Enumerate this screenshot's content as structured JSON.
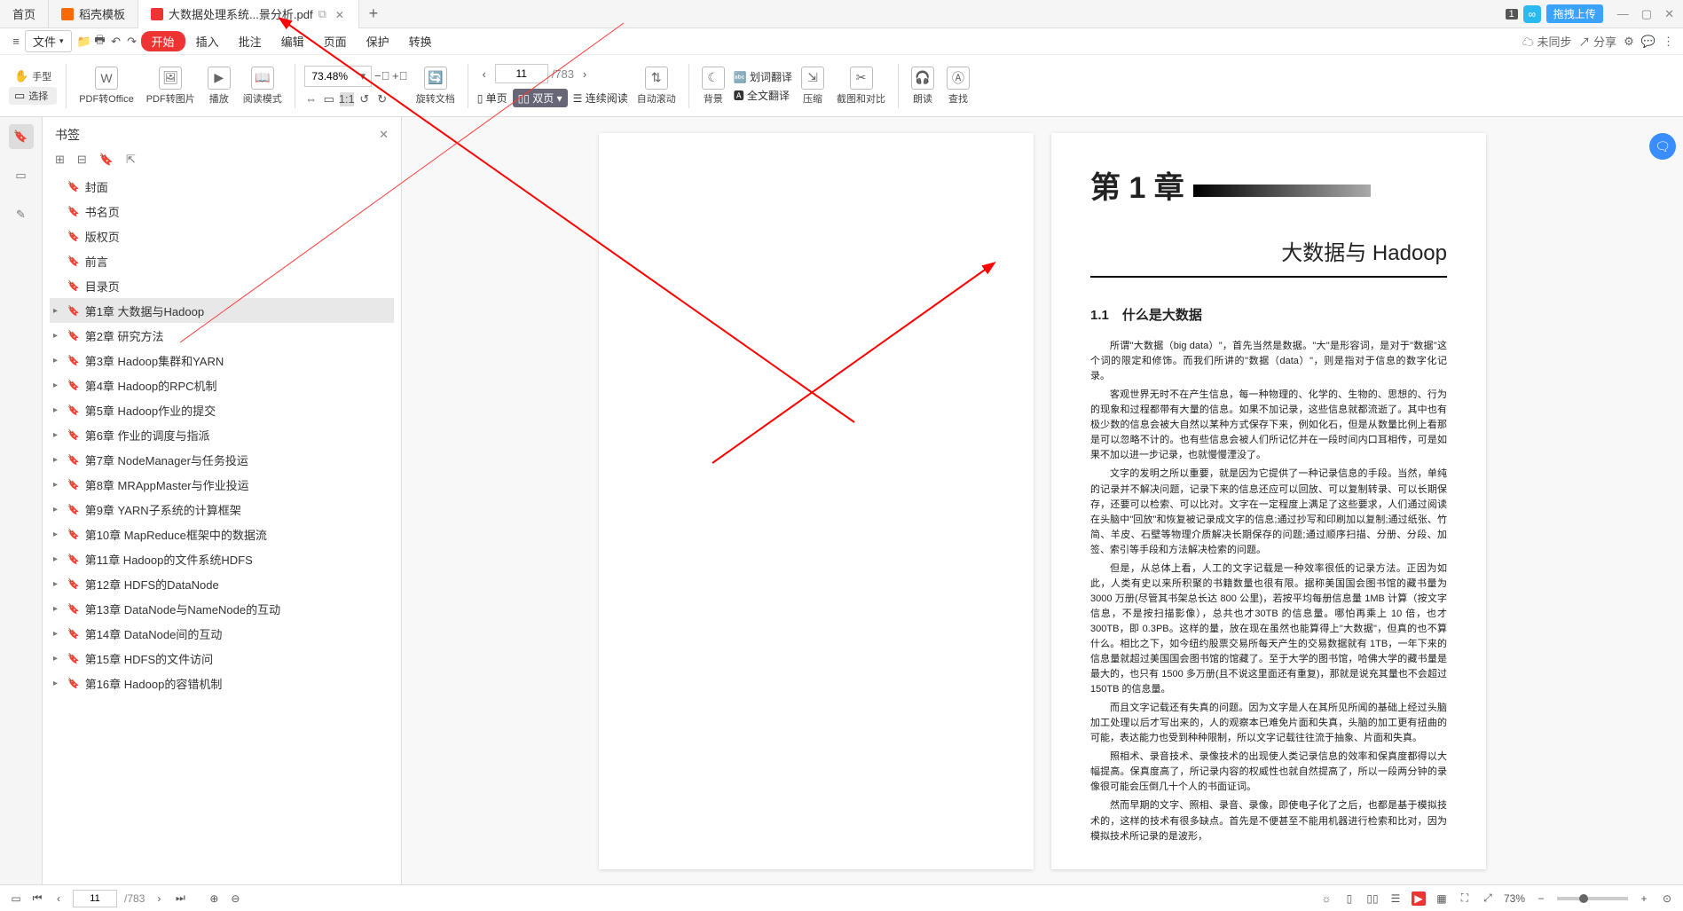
{
  "tabs": {
    "home": "首页",
    "t1": "稻壳模板",
    "t2": "大数据处理系统...景分析.pdf"
  },
  "badge": "1",
  "upload": "拖拽上传",
  "menu": {
    "file": "文件",
    "start": "开始",
    "insert": "插入",
    "annotate": "批注",
    "edit": "编辑",
    "page": "页面",
    "protect": "保护",
    "convert": "转换",
    "unsync": "未同步",
    "share": "分享"
  },
  "tool": {
    "hand": "手型",
    "select": "选择",
    "pdf2office": "PDF转Office",
    "pdf2img": "PDF转图片",
    "play": "播放",
    "readmode": "阅读模式",
    "zoom": "73.48%",
    "rotate": "旋转文档",
    "pagecur": "11",
    "pagetot": "/783",
    "single": "单页",
    "double": "双页",
    "continuous": "连续阅读",
    "autoscroll": "自动滚动",
    "background": "背景",
    "wordtrans": "划词翻译",
    "fulltrans": "全文翻译",
    "compress": "压缩",
    "screenshot": "截图和对比",
    "read": "朗读",
    "find": "查找"
  },
  "bookmarks": {
    "title": "书签",
    "items": [
      {
        "t": "封面",
        "e": false
      },
      {
        "t": "书名页",
        "e": false
      },
      {
        "t": "版权页",
        "e": false
      },
      {
        "t": "前言",
        "e": false
      },
      {
        "t": "目录页",
        "e": false
      },
      {
        "t": "第1章  大数据与Hadoop",
        "e": true,
        "sel": true
      },
      {
        "t": "第2章  研究方法",
        "e": true
      },
      {
        "t": "第3章  Hadoop集群和YARN",
        "e": true
      },
      {
        "t": "第4章  Hadoop的RPC机制",
        "e": true
      },
      {
        "t": "第5章  Hadoop作业的提交",
        "e": true
      },
      {
        "t": "第6章  作业的调度与指派",
        "e": true
      },
      {
        "t": "第7章  NodeManager与任务投运",
        "e": true
      },
      {
        "t": "第8章  MRAppMaster与作业投运",
        "e": true
      },
      {
        "t": "第9章  YARN子系统的计算框架",
        "e": true
      },
      {
        "t": "第10章  MapReduce框架中的数据流",
        "e": true
      },
      {
        "t": "第11章  Hadoop的文件系统HDFS",
        "e": true
      },
      {
        "t": "第12章  HDFS的DataNode",
        "e": true
      },
      {
        "t": "第13章  DataNode与NameNode的互动",
        "e": true
      },
      {
        "t": "第14章  DataNode间的互动",
        "e": true
      },
      {
        "t": "第15章  HDFS的文件访问",
        "e": true
      },
      {
        "t": "第16章  Hadoop的容错机制",
        "e": true
      }
    ]
  },
  "page": {
    "chapter": "第 1 章",
    "title": "大数据与 Hadoop",
    "h1": "1.1　什么是大数据",
    "para": [
      "所谓\"大数据（big data）\"，首先当然是数据。\"大\"是形容词，是对于\"数据\"这个词的限定和修饰。而我们所讲的\"数据（data）\"，则是指对于信息的数字化记录。",
      "客观世界无时不在产生信息，每一种物理的、化学的、生物的、思想的、行为的现象和过程都带有大量的信息。如果不加记录，这些信息就都流逝了。其中也有极少数的信息会被大自然以某种方式保存下来，例如化石，但是从数量比例上看那是可以忽略不计的。也有些信息会被人们所记忆并在一段时间内口耳相传，可是如果不加以进一步记录，也就慢慢湮没了。",
      "文字的发明之所以重要，就是因为它提供了一种记录信息的手段。当然，单纯的记录并不解决问题，记录下来的信息还应可以回放、可以复制转录、可以长期保存，还要可以检索、可以比对。文字在一定程度上满足了这些要求，人们通过阅读在头脑中\"回放\"和恢复被记录成文字的信息;通过抄写和印刷加以复制;通过纸张、竹简、羊皮、石壁等物理介质解决长期保存的问题;通过顺序扫描、分册、分段、加签、索引等手段和方法解决检索的问题。",
      "但是，从总体上看，人工的文字记载是一种效率很低的记录方法。正因为如此，人类有史以来所积聚的书籍数量也很有限。据称美国国会图书馆的藏书量为 3000 万册(尽管其书架总长达 800 公里)，若按平均每册信息量 1MB 计算（按文字信息，不是按扫描影像），总共也才30TB 的信息量。哪怕再乘上 10 倍，也才 300TB，即 0.3PB。这样的量，放在现在虽然也能算得上\"大数据\"，但真的也不算什么。相比之下，如今纽约股票交易所每天产生的交易数据就有 1TB，一年下来的信息量就超过美国国会图书馆的馆藏了。至于大学的图书馆，哈佛大学的藏书量是最大的，也只有 1500 多万册(且不说这里面还有重复)，那就是说充其量也不会超过 150TB 的信息量。",
      "而且文字记载还有失真的问题。因为文字是人在其所见所闻的基础上经过头脑加工处理以后才写出来的，人的观察本已难免片面和失真，头脑的加工更有扭曲的可能，表达能力也受到种种限制，所以文字记载往往流于抽象、片面和失真。",
      "照相术、录音技术、录像技术的出现使人类记录信息的效率和保真度都得以大幅提高。保真度高了，所记录内容的权威性也就自然提高了，所以一段两分钟的录像很可能会压倒几十个人的书面证词。",
      "然而早期的文字、照相、录音、录像，即使电子化了之后，也都是基于模拟技术的，这样的技术有很多缺点。首先是不便甚至不能用机器进行检索和比对，因为模拟技术所记录的是波形，"
    ]
  },
  "status": {
    "page": "11",
    "total": "/783",
    "zoom": "73%"
  }
}
